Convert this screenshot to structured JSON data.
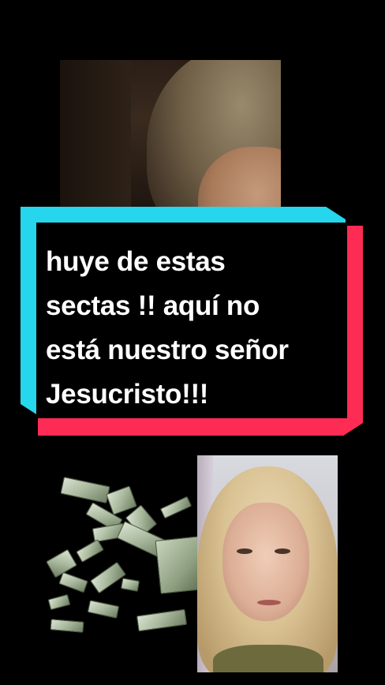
{
  "caption": {
    "lines": [
      "huye de estas",
      "sectas !! aquí no",
      "está nuestro señor",
      "Jesucristo!!!"
    ]
  },
  "colors": {
    "background": "#000000",
    "caption_cyan": "#25d6ec",
    "caption_red": "#fe2c55",
    "caption_text": "#ffffff"
  },
  "media": {
    "top_still": "man-video-still",
    "bottom_left": "falling-money-graphic",
    "bottom_right": "woman-webcam-feed"
  }
}
